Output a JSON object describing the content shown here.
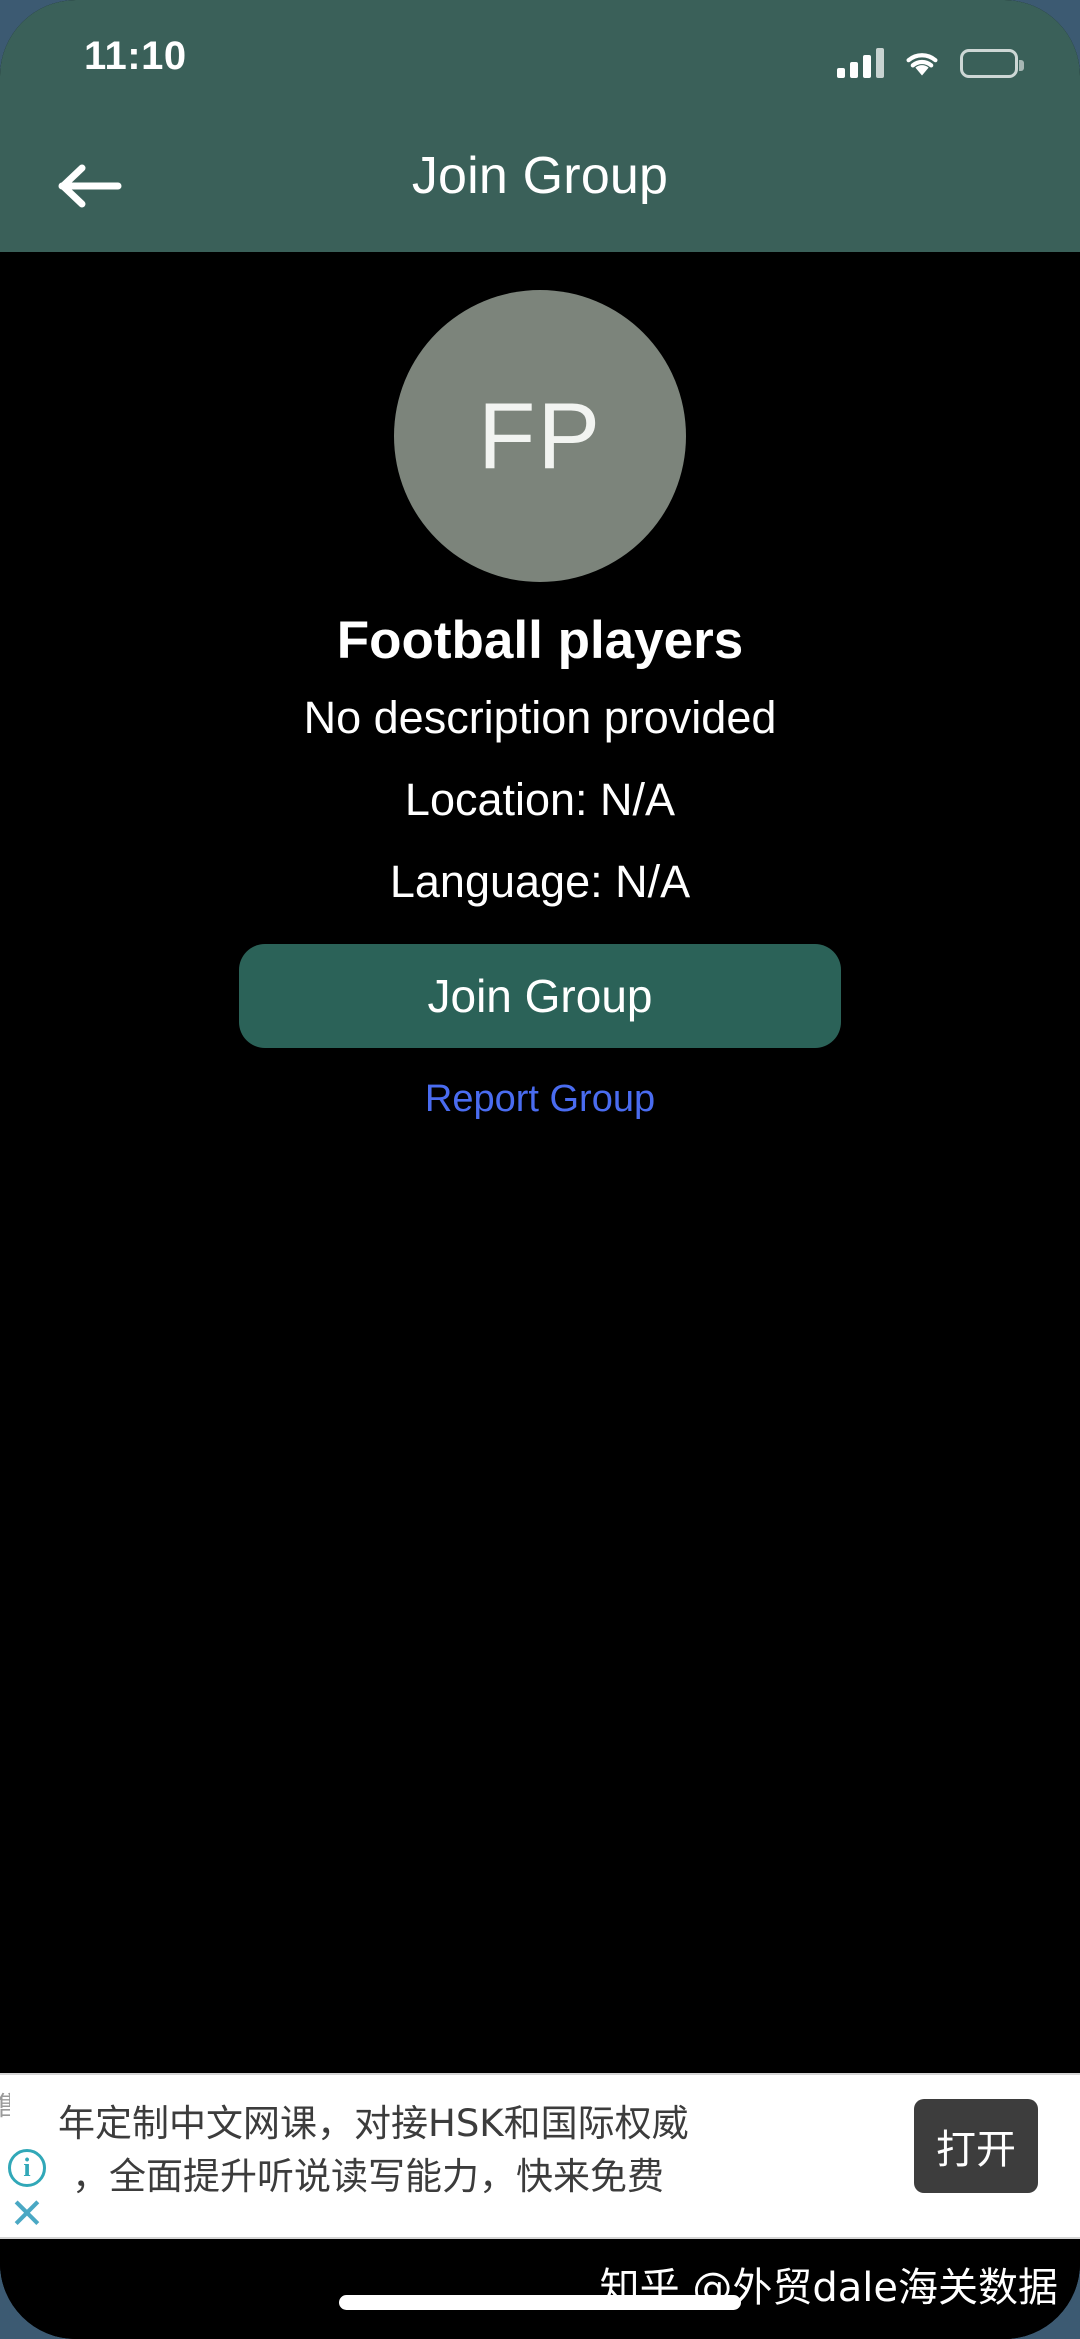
{
  "status_bar": {
    "time": "11:10",
    "cellular_icon": "signal-bars-icon",
    "wifi_icon": "wifi-icon",
    "battery_icon": "battery-full-icon"
  },
  "nav_bar": {
    "back_icon": "arrow-left-icon",
    "title": "Join Group",
    "background_color": "#3a6059"
  },
  "group": {
    "avatar_initials": "FP",
    "avatar_color": "#7c847b",
    "name": "Football players",
    "description": "No description provided",
    "location": "Location: N/A",
    "language": "Language: N/A"
  },
  "actions": {
    "join_button_label": "Join Group",
    "join_button_color": "#2b6258",
    "report_link_label": "Report Group",
    "report_link_color": "#4a6cf0"
  },
  "ad": {
    "ghost_text": "售",
    "info_icon": "info-circle-icon",
    "close_icon": "close-x-icon",
    "body_line_1": "年定制中文网课，对接HSK和国际权威",
    "body_line_2": "，全面提升听说读写能力，快来免费",
    "cta_label": "打开",
    "cta_color": "#3d3d3d",
    "background_color": "#ffffff"
  },
  "footer": {
    "watermark": "知乎 @外贸dale海关数据",
    "home_indicator": "home-indicator-bar"
  },
  "theme": {
    "screen_background": "#000000",
    "device_backdrop": "#3c5a72",
    "text_primary": "#ffffff"
  }
}
